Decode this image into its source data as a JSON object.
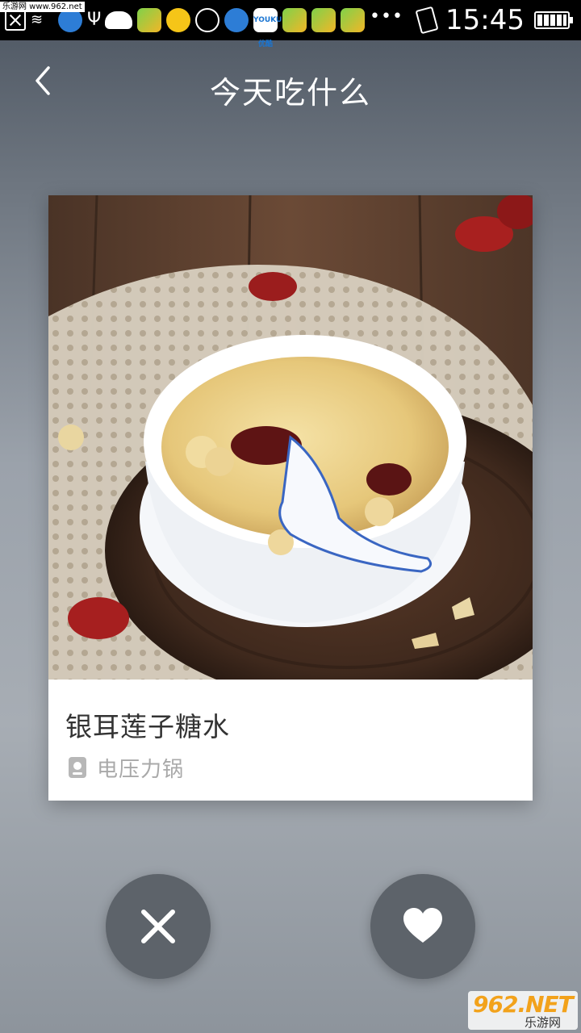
{
  "status_bar": {
    "watermark": "乐游网 www.962.net",
    "time": "15:45",
    "youku_label": "YOUKU 优酷",
    "overflow_dots": "•••"
  },
  "header": {
    "title": "今天吃什么"
  },
  "card": {
    "dish_name": "银耳莲子糖水",
    "cookware": "电压力锅"
  },
  "site_logo": {
    "main": "962.NET",
    "sub": "乐游网"
  },
  "colors": {
    "action_button": "#5d636a",
    "cookware_text": "#a9a9a9",
    "dish_text": "#333333"
  }
}
